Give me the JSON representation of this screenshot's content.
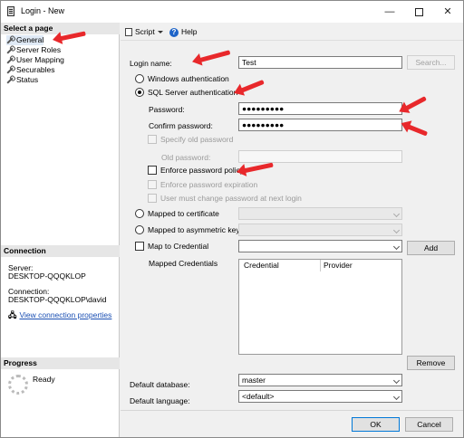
{
  "window": {
    "title": "Login - New"
  },
  "left": {
    "select_page": "Select a page",
    "pages": [
      "General",
      "Server Roles",
      "User Mapping",
      "Securables",
      "Status"
    ],
    "connection_header": "Connection",
    "server_label": "Server:",
    "server_value": "DESKTOP-QQQKLOP",
    "connection_label": "Connection:",
    "connection_value": "DESKTOP-QQQKLOP\\david",
    "view_link": "View connection properties",
    "progress_header": "Progress",
    "progress_status": "Ready"
  },
  "toolbar": {
    "script": "Script",
    "help": "Help"
  },
  "form": {
    "login_name_label": "Login name:",
    "login_name_value": "Test",
    "search_button": "Search...",
    "windows_auth": "Windows authentication",
    "sql_auth": "SQL Server authentication",
    "password_label": "Password:",
    "password_value": "●●●●●●●●●",
    "confirm_label": "Confirm password:",
    "confirm_value": "●●●●●●●●●",
    "specify_old": "Specify old password",
    "old_password_label": "Old password:",
    "enforce_policy": "Enforce password policy",
    "enforce_expiration": "Enforce password expiration",
    "must_change": "User must change password at next login",
    "mapped_cert": "Mapped to certificate",
    "mapped_asym": "Mapped to asymmetric key",
    "map_credential": "Map to Credential",
    "add_button": "Add",
    "mapped_credentials": "Mapped Credentials",
    "col_credential": "Credential",
    "col_provider": "Provider",
    "remove_button": "Remove",
    "default_db_label": "Default database:",
    "default_db_value": "master",
    "default_lang_label": "Default language:",
    "default_lang_value": "<default>"
  },
  "footer": {
    "ok": "OK",
    "cancel": "Cancel"
  },
  "colors": {
    "arrow": "#e8282b",
    "link": "#1a4fb3"
  }
}
